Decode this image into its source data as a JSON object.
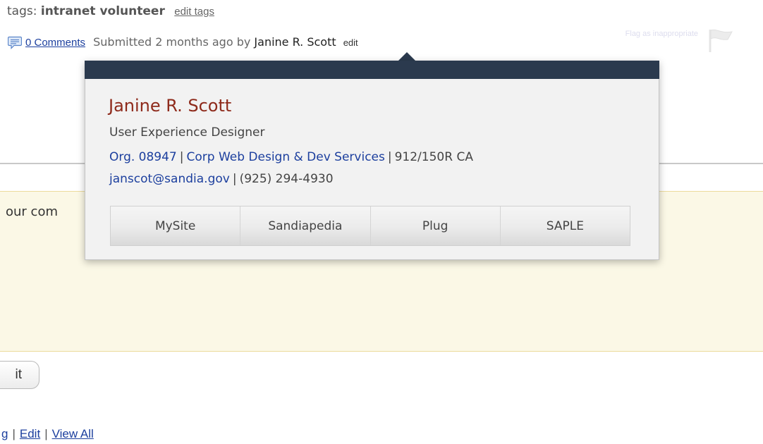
{
  "post_meta": {
    "tags_label": "tags:",
    "tags_value": "intranet volunteer",
    "edit_tags_label": "edit tags",
    "comments_link": "0 Comments",
    "submitted_text": "Submitted 2 months ago by",
    "author_name": "Janine R. Scott",
    "edit_label": "edit",
    "flag_label": "Flag as inappropriate",
    "comment_icon": "speech-bubble-icon",
    "flag_icon": "flag-icon"
  },
  "popover": {
    "name": "Janine R. Scott",
    "title": "User Experience Designer",
    "org": "Org. 08947",
    "department": "Corp Web Design & Dev Services",
    "location": "912/150R CA",
    "email": "janscot@sandia.gov",
    "phone": "(925) 294-4930",
    "separator": "|",
    "buttons": [
      "MySite",
      "Sandiapedia",
      "Plug",
      "SAPLE"
    ]
  },
  "comment_form": {
    "prompt_fragment": "our com",
    "submit_fragment": "it"
  },
  "bottom_links": {
    "first_fragment": "g",
    "edit": "Edit",
    "view_all": "View All",
    "separator": "|"
  },
  "colors": {
    "popover_bar": "#2b3a4e",
    "name_color": "#8e2a1b",
    "link_color": "#1c3f9e",
    "comment_area_bg": "#fbf8e6"
  }
}
